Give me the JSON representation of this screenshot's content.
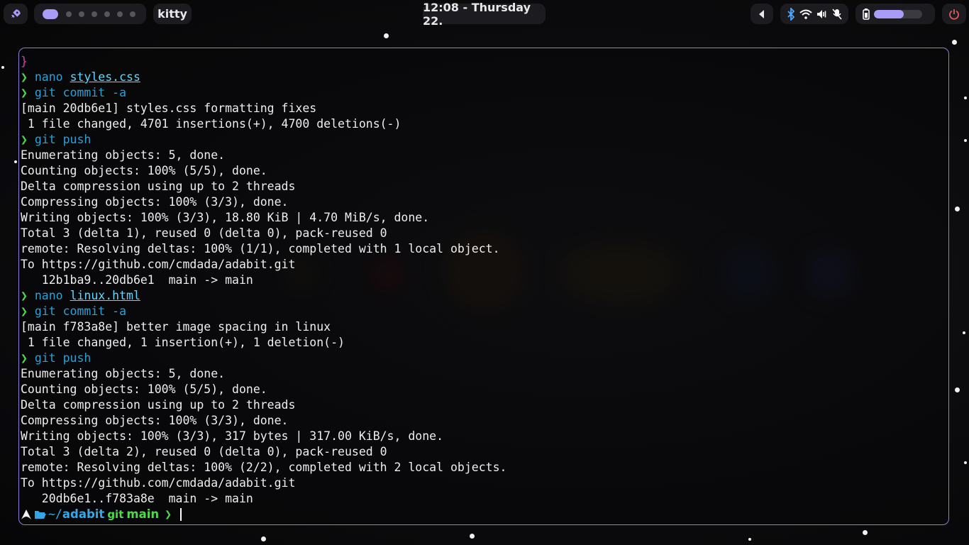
{
  "topbar": {
    "launcher_icon": "rocket-icon",
    "app_title": "kitty",
    "clock": "12:08 - Thursday 22.",
    "tray_icons": [
      "chevron-left-icon",
      "bluetooth-icon",
      "wifi-icon",
      "volume-icon",
      "mic-muted-icon",
      "battery-icon"
    ],
    "battery_level": 0.62,
    "power_icon": "power-icon",
    "workspaces": {
      "active": 1,
      "count": 7
    }
  },
  "colors": {
    "accent": "#a79cf7",
    "border": "#8b7fd8",
    "prompt_green": "#4fd94a",
    "command_blue": "#2aa1d6",
    "link_cyan": "#5fd7ff"
  },
  "terminal": {
    "lines": [
      {
        "type": "brace",
        "text": "}"
      },
      {
        "type": "cmd",
        "arrow": "❯",
        "cmd": "nano",
        "arg": "styles.css",
        "arg_link": true
      },
      {
        "type": "cmd",
        "arrow": "❯",
        "cmd": "git commit -a",
        "arg": ""
      },
      {
        "type": "out",
        "text": "[main 20db6e1] styles.css formatting fixes"
      },
      {
        "type": "out",
        "text": " 1 file changed, 4701 insertions(+), 4700 deletions(-)"
      },
      {
        "type": "cmd",
        "arrow": "❯",
        "cmd": "git push",
        "arg": ""
      },
      {
        "type": "out",
        "text": "Enumerating objects: 5, done."
      },
      {
        "type": "out",
        "text": "Counting objects: 100% (5/5), done."
      },
      {
        "type": "out",
        "text": "Delta compression using up to 2 threads"
      },
      {
        "type": "out",
        "text": "Compressing objects: 100% (3/3), done."
      },
      {
        "type": "out",
        "text": "Writing objects: 100% (3/3), 18.80 KiB | 4.70 MiB/s, done."
      },
      {
        "type": "out",
        "text": "Total 3 (delta 1), reused 0 (delta 0), pack-reused 0"
      },
      {
        "type": "out",
        "text": "remote: Resolving deltas: 100% (1/1), completed with 1 local object."
      },
      {
        "type": "out",
        "text": "To https://github.com/cmdada/adabit.git"
      },
      {
        "type": "out",
        "text": "   12b1ba9..20db6e1  main -> main"
      },
      {
        "type": "cmd",
        "arrow": "❯",
        "cmd": "nano",
        "arg": "linux.html",
        "arg_link": true
      },
      {
        "type": "cmd",
        "arrow": "❯",
        "cmd": "git commit -a",
        "arg": ""
      },
      {
        "type": "out",
        "text": "[main f783a8e] better image spacing in linux"
      },
      {
        "type": "out",
        "text": " 1 file changed, 1 insertion(+), 1 deletion(-)"
      },
      {
        "type": "cmd",
        "arrow": "❯",
        "cmd": "git push",
        "arg": ""
      },
      {
        "type": "out",
        "text": "Enumerating objects: 5, done."
      },
      {
        "type": "out",
        "text": "Counting objects: 100% (5/5), done."
      },
      {
        "type": "out",
        "text": "Delta compression using up to 2 threads"
      },
      {
        "type": "out",
        "text": "Compressing objects: 100% (3/3), done."
      },
      {
        "type": "out",
        "text": "Writing objects: 100% (3/3), 317 bytes | 317.00 KiB/s, done."
      },
      {
        "type": "out",
        "text": "Total 3 (delta 2), reused 0 (delta 0), pack-reused 0"
      },
      {
        "type": "out",
        "text": "remote: Resolving deltas: 100% (2/2), completed with 2 local objects."
      },
      {
        "type": "out",
        "text": "To https://github.com/cmdada/adabit.git"
      },
      {
        "type": "out",
        "text": "   20db6e1..f783a8e  main -> main"
      }
    ],
    "prompt": {
      "distro_icon": "arch-logo-icon",
      "folder_icon": "folder-open-icon",
      "path_prefix": "~/",
      "path_dir": "adabit",
      "git_label": "git",
      "branch": "main",
      "chevron": "❯"
    }
  }
}
